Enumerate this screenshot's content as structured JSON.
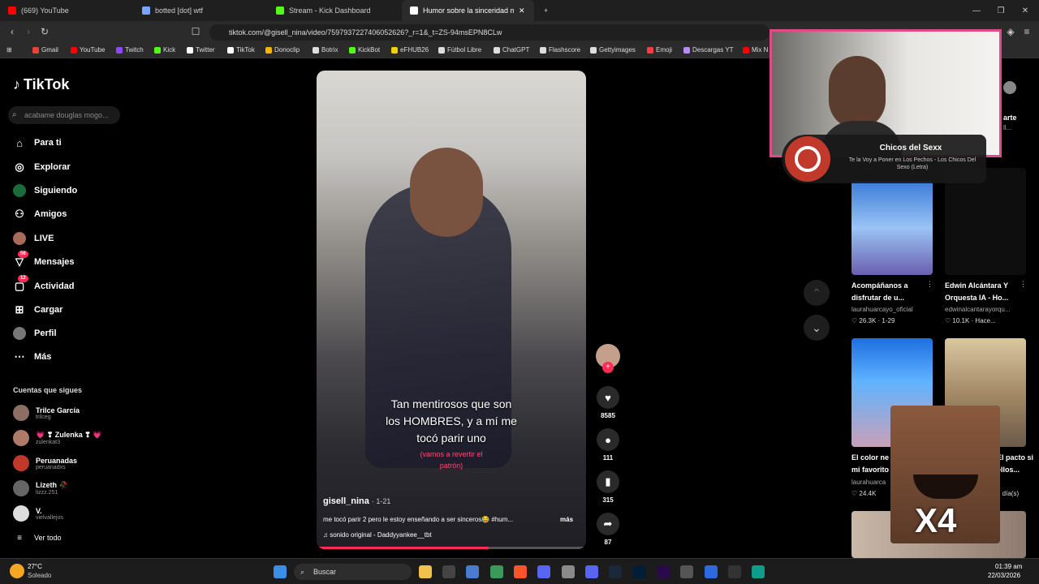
{
  "tabs": [
    {
      "title": "(669) YouTube",
      "color": "#ff0000"
    },
    {
      "title": "botted [dot] wtf",
      "color": "#7aa5ff"
    },
    {
      "title": "Stream - Kick Dashboard",
      "color": "#53fc18"
    },
    {
      "title": "Humor sobre la sinceridad m",
      "color": "#ffffff"
    }
  ],
  "window": {
    "minimize": "—",
    "restore": "❐",
    "close": "✕"
  },
  "url": "tiktok.com/@gisell_nina/video/7597937227406052626?_r=1&_t=ZS-94msEPN8CLw",
  "bookmarks": [
    {
      "label": "Gmail",
      "color": "#ea4335"
    },
    {
      "label": "YouTube",
      "color": "#ff0000"
    },
    {
      "label": "Twitch",
      "color": "#9146ff"
    },
    {
      "label": "Kick",
      "color": "#53fc18"
    },
    {
      "label": "Twitter",
      "color": "#ffffff"
    },
    {
      "label": "TikTok",
      "color": "#ffffff"
    },
    {
      "label": "Donoclip",
      "color": "#f5b400"
    },
    {
      "label": "Botrix",
      "color": "#dddddd"
    },
    {
      "label": "KickBot",
      "color": "#53fc18"
    },
    {
      "label": "eFHUB26",
      "color": "#f5d000"
    },
    {
      "label": "Fútbol Libre",
      "color": "#dddddd"
    },
    {
      "label": "ChatGPT",
      "color": "#dddddd"
    },
    {
      "label": "Flashscore",
      "color": "#dddddd"
    },
    {
      "label": "Gettyimages",
      "color": "#dddddd"
    },
    {
      "label": "Emoji",
      "color": "#ff3b3b"
    },
    {
      "label": "Descargas YT",
      "color": "#b98aff"
    },
    {
      "label": "Mix N",
      "color": "#ff0000"
    }
  ],
  "brand": "TikTok",
  "search_placeholder": "acabame douglas mogo...",
  "nav": [
    {
      "label": "Para ti",
      "icon": "⌂"
    },
    {
      "label": "Explorar",
      "icon": "◎"
    },
    {
      "label": "Siguiendo",
      "icon": "●"
    },
    {
      "label": "Amigos",
      "icon": "⚇"
    },
    {
      "label": "LIVE",
      "icon": "●"
    },
    {
      "label": "Mensajes",
      "icon": "▽",
      "badge": "56"
    },
    {
      "label": "Actividad",
      "icon": "▢",
      "badge": "12"
    },
    {
      "label": "Cargar",
      "icon": "⊞"
    },
    {
      "label": "Perfil",
      "icon": "●"
    },
    {
      "label": "Más",
      "icon": "⋯"
    }
  ],
  "following_header": "Cuentas que sigues",
  "following": [
    {
      "name": "Trilce García",
      "user": "trilceg"
    },
    {
      "name": "💗 ❣ Zulenka ❣ 💗",
      "user": "zulenkat3"
    },
    {
      "name": "Peruanadas",
      "user": "peruanadxs"
    },
    {
      "name": "Lizeth 🥀",
      "user": "lizzz.251"
    },
    {
      "name": "V.",
      "user": "vielvallejos"
    }
  ],
  "see_all": "Ver todo",
  "video": {
    "caption": [
      "Tan mentirosos que son",
      "los HOMBRES, y a mí me",
      "tocó parir uno"
    ],
    "subcaption": [
      "(vamos a revertir el",
      "patrón)"
    ],
    "author": "gisell_nina",
    "date": "· 1-21",
    "description": "me tocó parir 2 pero le estoy enseñando a ser sinceros😂 #hum...",
    "more": "más",
    "sound": "sonido original - Daddyyankee__tbt",
    "progress": 0.64
  },
  "actions": {
    "likes": "8585",
    "comments": "111",
    "saves": "315",
    "shares": "87"
  },
  "related": [
    {
      "title": [
        "Acompáñanos a",
        "disfrutar de u..."
      ],
      "user": "laurahuarcayo_oficial",
      "stats": "♡ 26.3K · 1-29"
    },
    {
      "title": [
        "Edwin Alcántara Y",
        "Orquesta IA - Ho..."
      ],
      "user": "edwinalcantarayorqu...",
      "stats": "♡ 10.1K · Hace..."
    },
    {
      "title": [
        "El color ne",
        "mi favorito"
      ],
      "user": "laurahuarca",
      "stats": "♡ 24.4K"
    },
    {
      "title": [
        "El pacto si",
        "ellos..."
      ],
      "user": "",
      "stats": "2 día(s)"
    }
  ],
  "overlay": {
    "music_title": "Chicos del Sexx",
    "music_sub": "Te la Voy a Poner en Los Pechos - Los Chicos Del Sexo (Letra)",
    "multiplier": "X4",
    "cut_text_1": "arte",
    "cut_text_2": "ll..."
  },
  "taskbar": {
    "temp": "27°C",
    "weather": "Soleado",
    "search": "Buscar",
    "time": "01:39 am",
    "date": "22/03/2026"
  }
}
